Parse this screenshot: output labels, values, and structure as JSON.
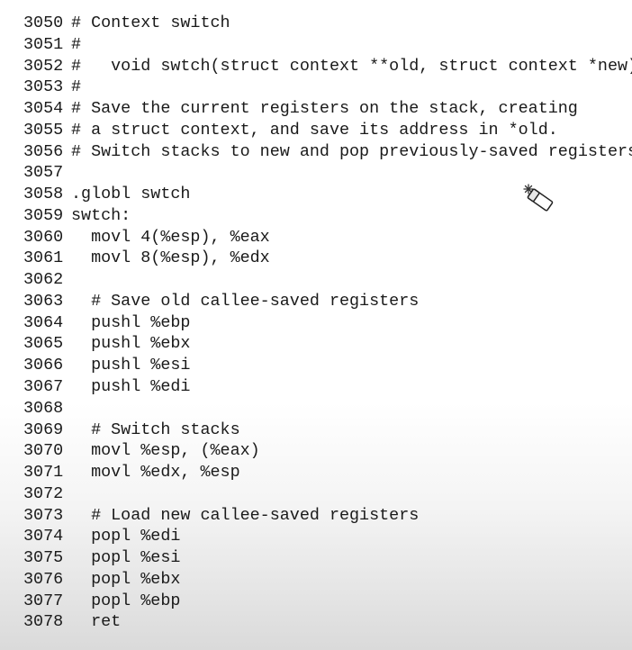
{
  "listing": {
    "lines": [
      {
        "num": "3050",
        "code": "# Context switch"
      },
      {
        "num": "3051",
        "code": "#"
      },
      {
        "num": "3052",
        "code": "#   void swtch(struct context **old, struct context *new);"
      },
      {
        "num": "3053",
        "code": "#"
      },
      {
        "num": "3054",
        "code": "# Save the current registers on the stack, creating"
      },
      {
        "num": "3055",
        "code": "# a struct context, and save its address in *old."
      },
      {
        "num": "3056",
        "code": "# Switch stacks to new and pop previously-saved registers."
      },
      {
        "num": "3057",
        "code": ""
      },
      {
        "num": "3058",
        "code": ".globl swtch"
      },
      {
        "num": "3059",
        "code": "swtch:"
      },
      {
        "num": "3060",
        "code": "  movl 4(%esp), %eax"
      },
      {
        "num": "3061",
        "code": "  movl 8(%esp), %edx"
      },
      {
        "num": "3062",
        "code": ""
      },
      {
        "num": "3063",
        "code": "  # Save old callee-saved registers"
      },
      {
        "num": "3064",
        "code": "  pushl %ebp"
      },
      {
        "num": "3065",
        "code": "  pushl %ebx"
      },
      {
        "num": "3066",
        "code": "  pushl %esi"
      },
      {
        "num": "3067",
        "code": "  pushl %edi"
      },
      {
        "num": "3068",
        "code": ""
      },
      {
        "num": "3069",
        "code": "  # Switch stacks"
      },
      {
        "num": "3070",
        "code": "  movl %esp, (%eax)"
      },
      {
        "num": "3071",
        "code": "  movl %edx, %esp"
      },
      {
        "num": "3072",
        "code": ""
      },
      {
        "num": "3073",
        "code": "  # Load new callee-saved registers"
      },
      {
        "num": "3074",
        "code": "  popl %edi"
      },
      {
        "num": "3075",
        "code": "  popl %esi"
      },
      {
        "num": "3076",
        "code": "  popl %ebx"
      },
      {
        "num": "3077",
        "code": "  popl %ebp"
      },
      {
        "num": "3078",
        "code": "  ret"
      }
    ]
  },
  "cursor": {
    "icon": "eraser-pointer-icon"
  }
}
